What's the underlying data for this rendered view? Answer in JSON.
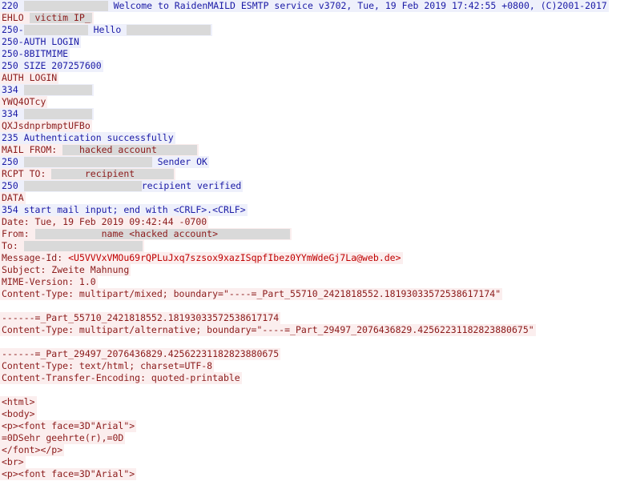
{
  "lines": [
    {
      "dir": "s",
      "segs": [
        {
          "t": "220 "
        },
        {
          "r": 105
        },
        {
          "t": " Welcome to RaidenMAILD ESMTP service v3702, Tue, 19 Feb 2019 17:42:55 +0800, (C)2001-2017"
        }
      ]
    },
    {
      "dir": "c",
      "segs": [
        {
          "t": "EHLO "
        },
        {
          "rl": " victim IP_ ",
          "w": 78
        }
      ]
    },
    {
      "dir": "s",
      "segs": [
        {
          "t": "250-"
        },
        {
          "r": 80
        },
        {
          "t": " Hello "
        },
        {
          "r": 105
        }
      ]
    },
    {
      "dir": "s",
      "segs": [
        {
          "t": "250-AUTH LOGIN"
        }
      ]
    },
    {
      "dir": "s",
      "segs": [
        {
          "t": "250-8BITMIME"
        }
      ]
    },
    {
      "dir": "s",
      "segs": [
        {
          "t": "250 SIZE 207257600"
        }
      ]
    },
    {
      "dir": "c",
      "segs": [
        {
          "t": "AUTH LOGIN"
        }
      ]
    },
    {
      "dir": "s",
      "segs": [
        {
          "t": "334 "
        },
        {
          "r": 85
        }
      ]
    },
    {
      "dir": "c",
      "segs": [
        {
          "t": "YWQ4OTcy"
        }
      ]
    },
    {
      "dir": "s",
      "segs": [
        {
          "t": "334 "
        },
        {
          "r": 85
        }
      ]
    },
    {
      "dir": "c",
      "segs": [
        {
          "t": "QXJsdnprbmptUFBo"
        }
      ]
    },
    {
      "dir": "s",
      "segs": [
        {
          "t": "235 Authentication successfully"
        }
      ]
    },
    {
      "dir": "c",
      "segs": [
        {
          "t": "MAIL FROM: "
        },
        {
          "rl": "   hacked account",
          "w": 168
        }
      ]
    },
    {
      "dir": "s",
      "segs": [
        {
          "t": "250 "
        },
        {
          "r": 160
        },
        {
          "t": " Sender OK"
        }
      ]
    },
    {
      "dir": "c",
      "segs": [
        {
          "t": "RCPT TO: "
        },
        {
          "rl": "      recipient",
          "w": 153
        }
      ]
    },
    {
      "dir": "s",
      "segs": [
        {
          "t": "250 "
        },
        {
          "r": 147
        },
        {
          "t": "recipient verified"
        }
      ]
    },
    {
      "dir": "c",
      "segs": [
        {
          "t": "DATA"
        }
      ]
    },
    {
      "dir": "s",
      "segs": [
        {
          "t": "354 start mail input; end with <CRLF>.<CRLF>"
        }
      ]
    },
    {
      "dir": "c",
      "segs": [
        {
          "t": "Date: Tue, 19 Feb 2019 09:42:44 -0700"
        }
      ]
    },
    {
      "dir": "c",
      "segs": [
        {
          "t": "From: "
        },
        {
          "rl": "            name <hacked account>",
          "w": 318
        }
      ]
    },
    {
      "dir": "c",
      "segs": [
        {
          "t": "To: "
        },
        {
          "r": 148
        }
      ]
    },
    {
      "dir": "c",
      "segs": [
        {
          "t": "Message-Id: "
        },
        {
          "t": "<U5VVVxVMOu69rQPLuJxq7szsox9xazISqpfIbez0YYmWdeGj7La@web.de>",
          "red": true
        }
      ]
    },
    {
      "dir": "c",
      "segs": [
        {
          "t": "Subject: Zweite Mahnung"
        }
      ]
    },
    {
      "dir": "c",
      "segs": [
        {
          "t": "MIME-Version: 1.0"
        }
      ]
    },
    {
      "dir": "c",
      "segs": [
        {
          "t": "Content-Type: multipart/mixed; boundary=\"----=_Part_55710_2421818552.18193033572538617174\""
        }
      ]
    },
    {
      "blank": true
    },
    {
      "dir": "c",
      "segs": [
        {
          "t": "------=_Part_55710_2421818552.18193033572538617174"
        }
      ]
    },
    {
      "dir": "c",
      "segs": [
        {
          "t": "Content-Type: multipart/alternative; boundary=\"----=_Part_29497_2076436829.42562231182823880675\""
        }
      ]
    },
    {
      "blank": true
    },
    {
      "dir": "c",
      "segs": [
        {
          "t": "------=_Part_29497_2076436829.42562231182823880675"
        }
      ]
    },
    {
      "dir": "c",
      "segs": [
        {
          "t": "Content-Type: text/html; charset=UTF-8"
        }
      ]
    },
    {
      "dir": "c",
      "segs": [
        {
          "t": "Content-Transfer-Encoding: quoted-printable"
        }
      ]
    },
    {
      "blank": true
    },
    {
      "dir": "c",
      "segs": [
        {
          "t": "<html>"
        }
      ]
    },
    {
      "dir": "c",
      "segs": [
        {
          "t": "<body>"
        }
      ]
    },
    {
      "dir": "c",
      "segs": [
        {
          "t": "<p><font face=3D\"Arial\">"
        }
      ]
    },
    {
      "dir": "c",
      "segs": [
        {
          "t": "=0DSehr geehrte(r),=0D"
        }
      ]
    },
    {
      "dir": "c",
      "segs": [
        {
          "t": "</font></p>"
        }
      ]
    },
    {
      "dir": "c",
      "segs": [
        {
          "t": "<br>"
        }
      ]
    },
    {
      "dir": "c",
      "segs": [
        {
          "t": "<p><font face=3D\"Arial\">"
        }
      ]
    }
  ]
}
